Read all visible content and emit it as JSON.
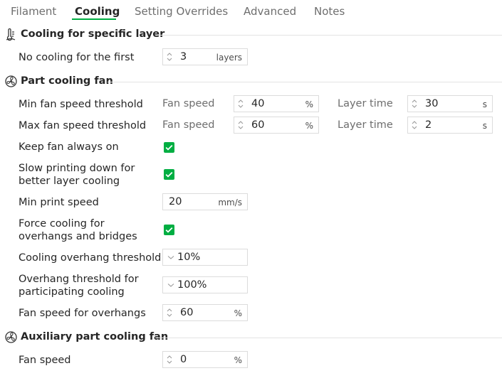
{
  "tabs": [
    {
      "label": "Filament",
      "active": false
    },
    {
      "label": "Cooling",
      "active": true
    },
    {
      "label": "Setting Overrides",
      "active": false
    },
    {
      "label": "Advanced",
      "active": false
    },
    {
      "label": "Notes",
      "active": false
    }
  ],
  "accent_color": "#00ae42",
  "sections": {
    "specific_layer": {
      "title": "Cooling for specific layer",
      "icon": "thermometer-fan-icon",
      "no_cooling": {
        "label": "No cooling for the first",
        "value": "3",
        "unit": "layers"
      }
    },
    "part_fan": {
      "title": "Part cooling fan",
      "icon": "fan-icon",
      "min_fan": {
        "label": "Min fan speed threshold",
        "fan_label": "Fan speed",
        "fan_value": "40",
        "fan_unit": "%",
        "time_label": "Layer time",
        "time_value": "30",
        "time_unit": "s"
      },
      "max_fan": {
        "label": "Max fan speed threshold",
        "fan_label": "Fan speed",
        "fan_value": "60",
        "fan_unit": "%",
        "time_label": "Layer time",
        "time_value": "2",
        "time_unit": "s"
      },
      "keep_fan": {
        "label": "Keep fan always on",
        "checked": true
      },
      "slow_down": {
        "label": "Slow printing down for better layer cooling",
        "checked": true
      },
      "min_print_speed": {
        "label": "Min print speed",
        "value": "20",
        "unit": "mm/s"
      },
      "force_cooling": {
        "label": "Force cooling for overhangs and bridges",
        "checked": true
      },
      "overhang_threshold": {
        "label": "Cooling overhang threshold",
        "value": "10%"
      },
      "participating": {
        "label": "Overhang threshold for participating cooling",
        "value": "100%"
      },
      "overhang_fan": {
        "label": "Fan speed for overhangs",
        "value": "60",
        "unit": "%"
      }
    },
    "aux_fan": {
      "title": "Auxiliary part cooling fan",
      "icon": "fan-icon",
      "fan_speed": {
        "label": "Fan speed",
        "value": "0",
        "unit": "%"
      }
    }
  }
}
